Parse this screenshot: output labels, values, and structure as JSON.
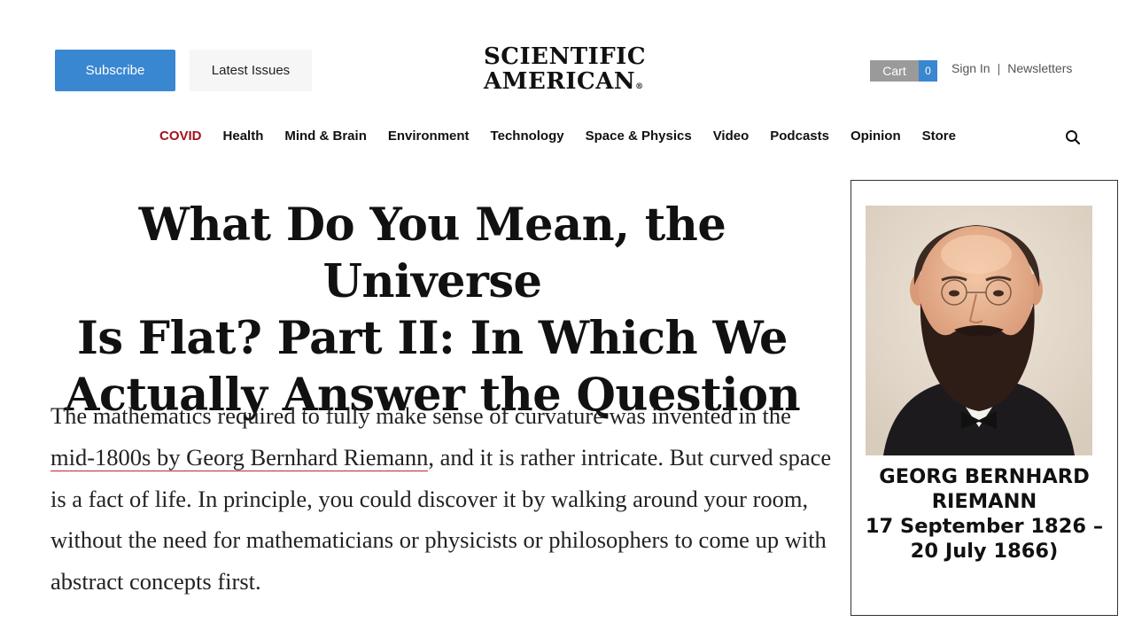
{
  "header": {
    "subscribe_label": "Subscribe",
    "latest_issues_label": "Latest Issues",
    "logo_line1": "SCIENTIFIC",
    "logo_line2": "AMERICAN",
    "logo_mark": "®",
    "cart_label": "Cart",
    "cart_count": "0",
    "sign_in_label": "Sign In",
    "separator": "|",
    "newsletters_label": "Newsletters"
  },
  "nav": {
    "items": [
      "COVID",
      "Health",
      "Mind & Brain",
      "Environment",
      "Technology",
      "Space & Physics",
      "Video",
      "Podcasts",
      "Opinion",
      "Store"
    ]
  },
  "article": {
    "headline_line1": "What Do You Mean, the Universe",
    "headline_line2": "Is Flat? Part II: In Which We",
    "headline_line3": "Actually Answer the Question",
    "body_pre": "The mathematics required to fully make sense of curvature was invented in the ",
    "body_link": "mid-1800s by Georg Bernhard Riemann",
    "body_post": ", and it is rather intricate. But curved space is a fact of life. In principle, you could discover it by walking around your room, without the need for mathematicians or physicists or philosophers to come up with abstract concepts first."
  },
  "sidebar": {
    "caption_line1": "GEORG BERNHARD",
    "caption_line2": "RIEMANN",
    "caption_line3": "17 September 1826 –",
    "caption_line4": "20 July 1866)"
  },
  "colors": {
    "accent_blue": "#3a87d1",
    "covid_red": "#a3121b",
    "link_underline": "#c0272d"
  }
}
